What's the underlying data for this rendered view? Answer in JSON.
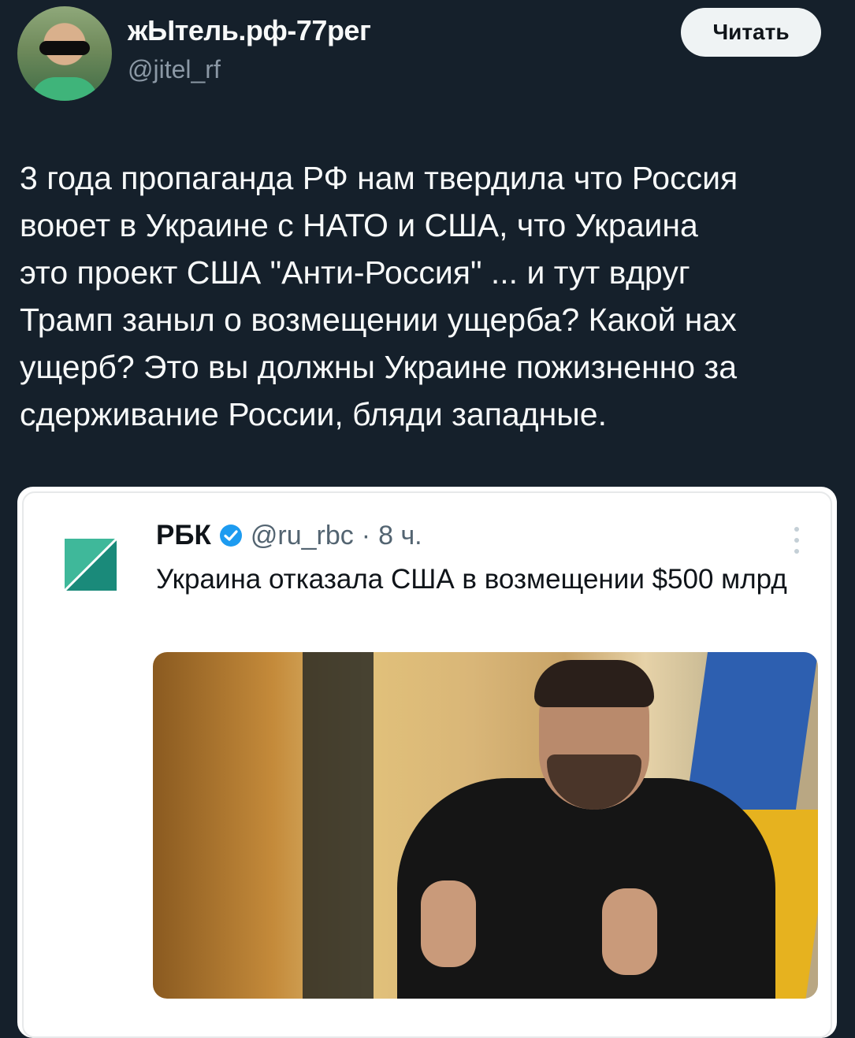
{
  "author": {
    "name": "жЫтель.рф-77рег",
    "handle": "@jitel_rf"
  },
  "follow_button": "Читать",
  "tweet_text": "3 года пропаганда РФ нам твердила что Россия\nвоюет в Украине с НАТО и США, что Украина\nэто проект США \"Анти-Россия\" ... и тут вдруг\nТрамп заныл о возмещении ущерба? Какой нах\nущерб? Это вы должны Украине пожизненно за\nсдерживание России, бляди западные.",
  "quoted": {
    "name": "РБК",
    "handle": "@ru_rbc",
    "separator": "·",
    "time": "8 ч.",
    "text": "Украина отказала США в возмещении $500 млрд"
  },
  "colors": {
    "background": "#15202b",
    "verified": "#1d9bf0",
    "rbc_logo": "#1a8a7a"
  }
}
